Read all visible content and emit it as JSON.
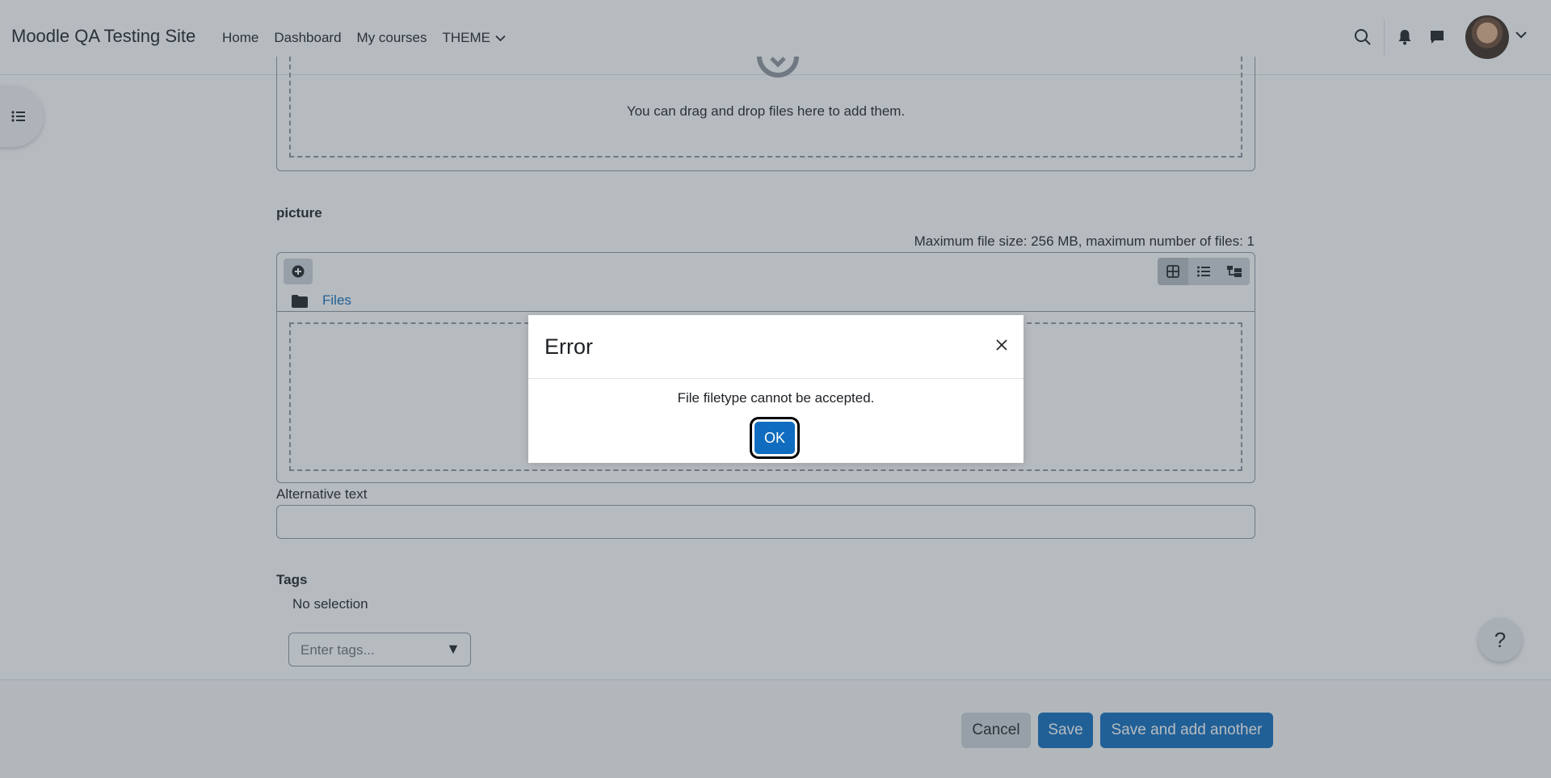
{
  "navbar": {
    "brand": "Moodle QA Testing Site",
    "links": [
      "Home",
      "Dashboard",
      "My courses"
    ],
    "theme_label": "THEME"
  },
  "upload_area_top": {
    "drop_text": "You can drag and drop files here to add them."
  },
  "picture_field": {
    "label": "picture",
    "max_info": "Maximum file size: 256 MB, maximum number of files: 1",
    "files_link": "Files"
  },
  "alt_text": {
    "label": "Alternative text",
    "value": ""
  },
  "tags": {
    "label": "Tags",
    "no_selection": "No selection",
    "placeholder": "Enter tags..."
  },
  "footer": {
    "cancel": "Cancel",
    "save": "Save",
    "save_add": "Save and add another"
  },
  "help_label": "?",
  "modal": {
    "title": "Error",
    "message": "File filetype cannot be accepted.",
    "ok": "OK"
  },
  "colors": {
    "primary": "#0f6cbf",
    "secondary": "#ced4da"
  }
}
